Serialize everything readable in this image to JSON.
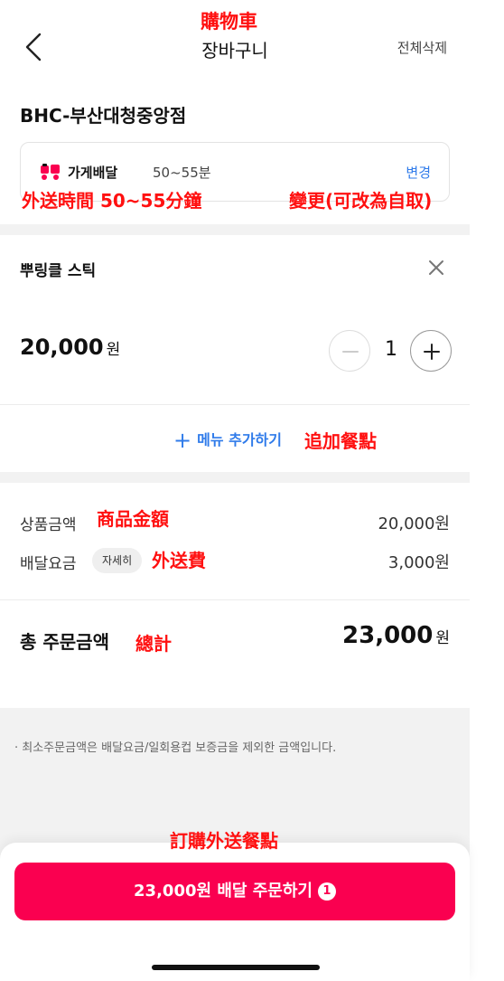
{
  "header": {
    "title": "장바구니",
    "delete_all": "전체삭제",
    "annotation": "購物車"
  },
  "store": {
    "name": "BHC-부산대청중앙점"
  },
  "delivery": {
    "label": "가게배달",
    "time": "50~55분",
    "change": "변경",
    "annotation_time": "外送時間 50~55分鐘",
    "annotation_change": "變更(可改為自取)"
  },
  "item": {
    "name": "뿌링클 스틱",
    "price": "20,000",
    "unit": "원",
    "quantity": "1",
    "minus": "−",
    "plus": "+",
    "remove": "×"
  },
  "add_menu": {
    "label": "메뉴 추가하기",
    "plus": "+",
    "annotation": "追加餐點"
  },
  "summary": {
    "product_label": "상품금액",
    "product_value": "20,000원",
    "product_annotation": "商品金額",
    "delivery_label": "배달요금",
    "delivery_detail": "자세히",
    "delivery_value": "3,000원",
    "delivery_annotation": "外送費",
    "total_label": "총 주문금액",
    "total_value": "23,000",
    "total_unit": "원",
    "total_annotation": "總計"
  },
  "note": "· 최소주문금액은 배달요금/일회용컵 보증금을 제외한 금액입니다.",
  "order": {
    "label": "23,000원 배달 주문하기",
    "count": "1",
    "annotation": "訂購外送餐點"
  },
  "colors": {
    "brand": "#fa0050",
    "link": "#2f7bea",
    "annotation": "#ff1010"
  }
}
